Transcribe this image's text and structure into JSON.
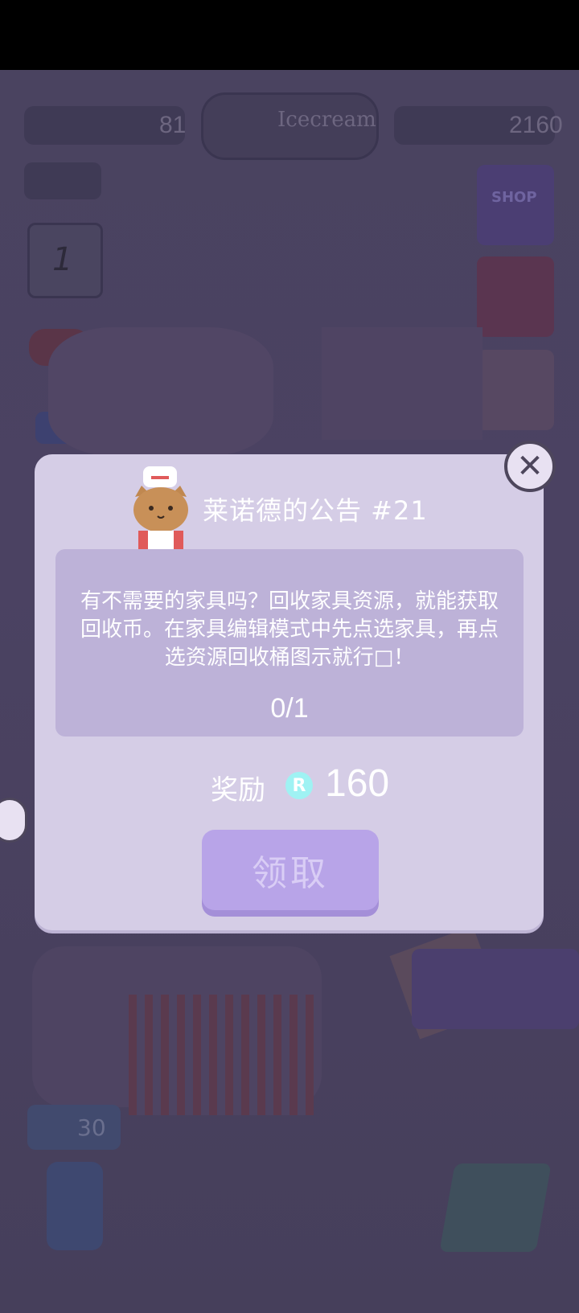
{
  "hud": {
    "level_value": "81",
    "shop_name": "Icecream",
    "coin_value": "2160",
    "shop_label": "SHOP",
    "calendar_day": "1",
    "counter_value": "30"
  },
  "dialog": {
    "title": "莱诺德的公告 #21",
    "message": "有不需要的家具吗？回收家具资源，就能获取回收币。在家具编辑模式中先点选家具，再点选资源回收桶图示就行□！",
    "progress": "0/1",
    "reward_label": "奖励",
    "reward_icon_letter": "R",
    "reward_amount": "160",
    "claim_label": "领取",
    "close_glyph": "✕"
  },
  "icons": [
    "close-icon",
    "recycle-coin-icon",
    "shop-cart-icon",
    "calendar-icon",
    "gamepad-icon",
    "map-pin-icon",
    "chef-cat-avatar"
  ],
  "colors": {
    "dialog_bg": "#d5cde6",
    "message_box_bg": "#bdb2d8",
    "claim_button_bg": "#b8a4e8",
    "recycle_coin": "#9ff2f3",
    "overlay_bg": "#4a4360"
  }
}
